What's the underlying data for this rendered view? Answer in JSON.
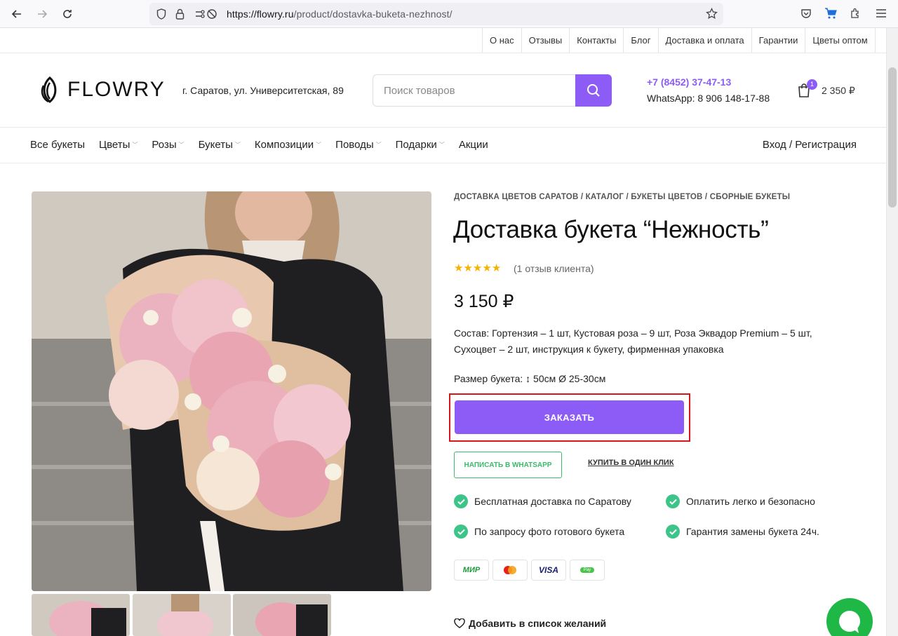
{
  "browser": {
    "url_domain": "https://flowry.ru",
    "url_path": "/product/dostavka-buketa-nezhnost/"
  },
  "top_links": [
    "О нас",
    "Отзывы",
    "Контакты",
    "Блог",
    "Доставка и оплата",
    "Гарантии",
    "Цветы оптом"
  ],
  "header": {
    "logo_text": "FLOWRY",
    "address": "г. Саратов, ул. Университетская, 89",
    "search_placeholder": "Поиск товаров",
    "phone": "+7 (8452) 37-47-13",
    "whatsapp": "WhatsApp: 8 906 148-17-88",
    "cart_count": "1",
    "cart_total": "2 350 ₽"
  },
  "nav": {
    "items": [
      {
        "label": "Все букеты",
        "dropdown": false
      },
      {
        "label": "Цветы",
        "dropdown": true
      },
      {
        "label": "Розы",
        "dropdown": true
      },
      {
        "label": "Букеты",
        "dropdown": true
      },
      {
        "label": "Композиции",
        "dropdown": true
      },
      {
        "label": "Поводы",
        "dropdown": true
      },
      {
        "label": "Подарки",
        "dropdown": true
      },
      {
        "label": "Акции",
        "dropdown": false
      }
    ],
    "login": "Вход / Регистрация"
  },
  "product": {
    "breadcrumb": [
      "ДОСТАВКА ЦВЕТОВ САРАТОВ",
      "КАТАЛОГ",
      "БУКЕТЫ ЦВЕТОВ",
      "СБОРНЫЕ БУКЕТЫ"
    ],
    "title": "Доставка букета “Нежность”",
    "rating_stars": 5,
    "reviews": "(1 отзыв клиента)",
    "price": "3 150 ₽",
    "composition": "Состав: Гортензия – 1 шт, Кустовая роза – 9 шт, Роза Эквадор Premium – 5 шт, Сухоцвет – 2 шт, инструкция к букету, фирменная упаковка",
    "size": "Размер букета: ↕ 50см Ø 25-30см",
    "order_button": "ЗАКАЗАТЬ",
    "whatsapp_button": "НАПИСАТЬ В WHATSAPP",
    "one_click": "КУПИТЬ В ОДИН КЛИК",
    "features": [
      "Бесплатная доставка по Саратову",
      "Оплатить легко и безопасно",
      "По запросу фото готового букета",
      "Гарантия замены букета 24ч."
    ],
    "payment_methods": [
      "МИР",
      "Mastercard",
      "VISA",
      "Pay"
    ],
    "wishlist": "Добавить в список желаний"
  },
  "colors": {
    "accent": "#8d5cf6",
    "highlight_border": "#d8171d",
    "whatsapp_green": "#3bba6b",
    "check_green": "#3cc489",
    "star": "#f5b301"
  }
}
